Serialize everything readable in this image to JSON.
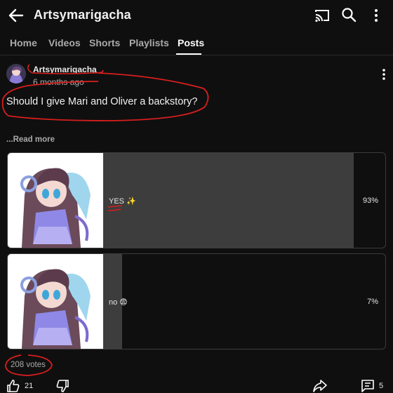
{
  "header": {
    "channel_name": "Artsymarigacha",
    "back_icon": "arrow-left-icon",
    "cast_icon": "cast-icon",
    "search_icon": "search-icon",
    "menu_icon": "more-vert-icon"
  },
  "tabs": [
    {
      "label": "Home",
      "active": false
    },
    {
      "label": "Videos",
      "active": false
    },
    {
      "label": "Shorts",
      "active": false
    },
    {
      "label": "Playlists",
      "active": false
    },
    {
      "label": "Posts",
      "active": true
    }
  ],
  "post": {
    "author": "Artsymarigacha",
    "time": "6 months ago",
    "text": "Should I give Mari and Oliver a backstory?",
    "read_more": "...Read more"
  },
  "poll": {
    "options": [
      {
        "label": "YES ✨",
        "percent": "93%",
        "fill_fraction": 0.93
      },
      {
        "label": "no 😨",
        "percent": "7%",
        "fill_fraction": 0.07
      }
    ],
    "votes": "208 votes"
  },
  "actions": {
    "like_count": "21",
    "comment_count": "5"
  },
  "colors": {
    "background": "#0f0f0f",
    "poll_fill": "#3d3d3d",
    "annotation": "#d81e1e"
  }
}
